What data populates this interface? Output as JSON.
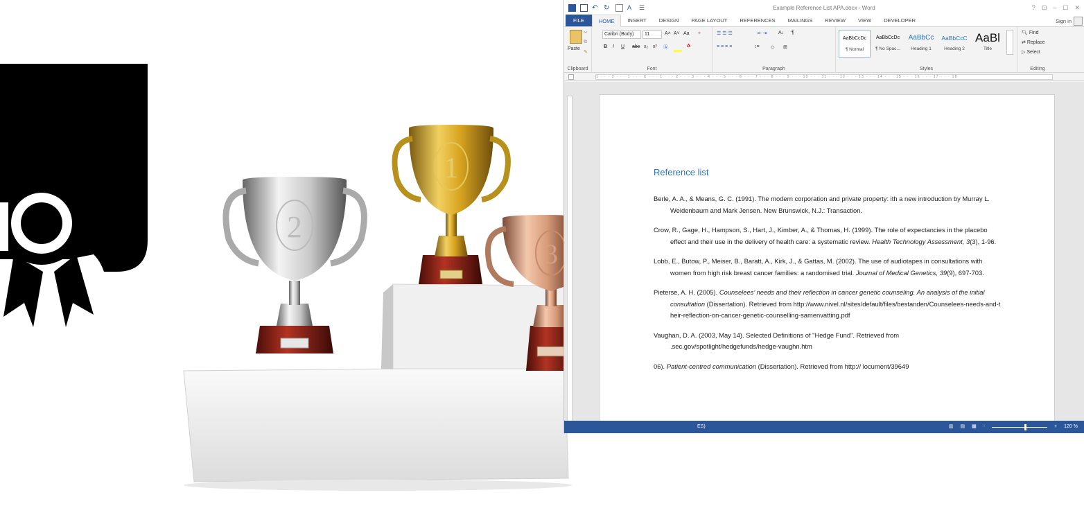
{
  "colors": {
    "word_blue": "#2b579a",
    "heading_blue": "#2e74b5",
    "badge_black": "#000000",
    "gold": "#d9a521",
    "silver": "#c9c9c9",
    "bronze": "#d69a78",
    "plinth_red": "#8e1f13"
  },
  "trophies": [
    {
      "label": "2",
      "icon": "silver-trophy"
    },
    {
      "label": "1",
      "icon": "gold-trophy"
    },
    {
      "label": "3",
      "icon": "bronze-trophy"
    }
  ],
  "word": {
    "title": "Example Reference List APA.docx - Word",
    "window_controls": {
      "help": "?",
      "restore_ribbon": "⊡",
      "minimize": "–",
      "maximize": "☐",
      "close": "✕"
    },
    "tabs": [
      "FILE",
      "HOME",
      "INSERT",
      "DESIGN",
      "PAGE LAYOUT",
      "REFERENCES",
      "MAILINGS",
      "REVIEW",
      "VIEW",
      "DEVELOPER"
    ],
    "active_tab": "HOME",
    "sign_in": "Sign in",
    "ribbon": {
      "clipboard": {
        "paste": "Paste",
        "label": "Clipboard"
      },
      "font": {
        "font_name": "Calibri (Body)",
        "font_size": "11",
        "label": "Font",
        "grow": "A˄",
        "shrink": "A˅",
        "case": "Aa",
        "bold": "B",
        "italic": "I",
        "underline": "U",
        "strike": "abc",
        "subscript": "x₂",
        "superscript": "x²"
      },
      "paragraph": {
        "label": "Paragraph",
        "sort": "A↓",
        "pilcrow": "¶"
      },
      "styles": {
        "label": "Styles",
        "items": [
          {
            "sample": "AaBbCcDc",
            "name": "¶ Normal"
          },
          {
            "sample": "AaBbCcDc",
            "name": "¶ No Spac..."
          },
          {
            "sample": "AaBbCc",
            "name": "Heading 1"
          },
          {
            "sample": "AaBbCcC",
            "name": "Heading 2"
          },
          {
            "sample": "AaBl",
            "name": "Title"
          }
        ]
      },
      "editing": {
        "label": "Editing",
        "find": "Find",
        "replace": "Replace",
        "select": "Select"
      }
    },
    "ruler": "1 · · · 2 · · · 1 · · · X · · · 1 · · · 2 · · · 3 · · · 4 · · · 5 · · · 6 · · · 7 · · · 8 · · · 9 · · · 10 · · · 11 · · · 12 · · · 13 · · · 14 · · · 15 · · · 16 · · · 17 · · · 18",
    "document": {
      "heading": "Reference list",
      "references": [
        {
          "text": "Berle, A. A., & Means, G. C. (1991). The modern corporation and private property: ith a new introduction by Murray L. Weidenbaum and Mark Jensen. New Brunswick, N.J.: Transaction."
        },
        {
          "before": "Crow, R., Gage, H., Hampson, S., Hart, J., Kimber, A., & Thomas, H. (1999). The role of expectancies in the placebo effect and their use in the delivery of health care: a systematic review. ",
          "italic": "Health Technology Assessment, 3",
          "after": "(3), 1-96."
        },
        {
          "before": "Lobb, E., Butow, P., Meiser, B., Baratt, A., Kirk, J., & Gattas, M. (2002). The use of audiotapes in consultations with women from high risk breast cancer families: a randomised trial. ",
          "italic": "Journal of Medical Genetics, 39",
          "after": "(9), 697-703."
        },
        {
          "before": "Pieterse, A. H. (2005). ",
          "italic": "Counselees’ needs and their reflection in cancer genetic counseling. An analysis of the initial consultation",
          "after": " (Dissertation). Retrieved from http://www.nivel.nl/sites/default/files/bestanden/Counselees-needs-and-their-reflection-on-cancer-genetic-counselling-samenvatting.pdf"
        },
        {
          "text": "Vaughan, D. A. (2003, May 14). Selected Definitions of \"Hedge Fund\". Retrieved from .sec.gov/spotlight/hedgefunds/hedge-vaughn.htm"
        },
        {
          "before": "06). ",
          "italic": "Patient-centred communication",
          "after": " (Dissertation). Retrieved from http:// locument/39649"
        }
      ]
    },
    "status": {
      "left": "ES)",
      "zoom": "120 %",
      "zoom_minus": "-",
      "zoom_plus": "+",
      "zoom_level": 0.6
    }
  }
}
